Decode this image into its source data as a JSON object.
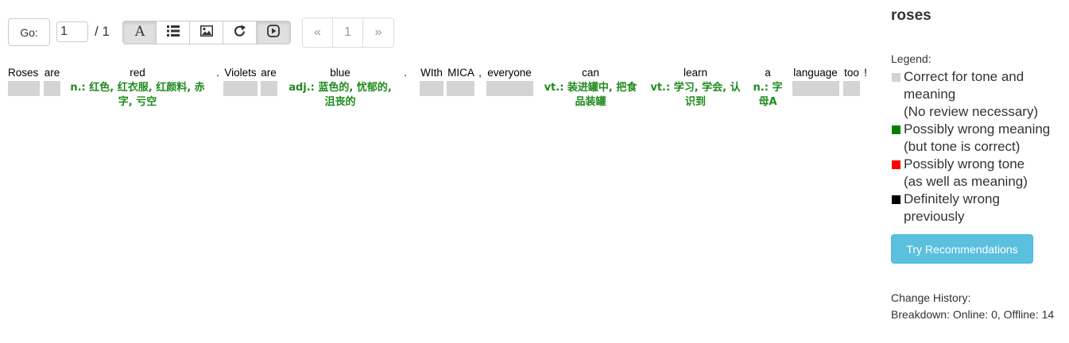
{
  "toolbar": {
    "go_label": "Go:",
    "page_value": "1",
    "page_total": "/ 1",
    "buttons": [
      {
        "icon": "font-icon"
      },
      {
        "icon": "list-icon"
      },
      {
        "icon": "image-icon"
      },
      {
        "icon": "share-icon"
      },
      {
        "icon": "play-icon"
      }
    ]
  },
  "pagination": {
    "prev": "«",
    "current": "1",
    "next": "»"
  },
  "words": [
    {
      "text": "Roses"
    },
    {
      "text": "are"
    },
    {
      "text": "red",
      "translation": [
        "n.: 红色, 红衣服, 红颜料, 赤",
        "字, 亏空"
      ]
    },
    {
      "text": "."
    },
    {
      "text": "Violets"
    },
    {
      "text": "are"
    },
    {
      "text": "blue",
      "translation": [
        "adj.: 蓝色的, 忧郁的,",
        "沮丧的"
      ]
    },
    {
      "text": "."
    },
    {
      "text": "WIth"
    },
    {
      "text": "MICA"
    },
    {
      "text": ","
    },
    {
      "text": "everyone"
    },
    {
      "text": "can",
      "translation": [
        "vt.: 装进罐中, 把食",
        "品装罐"
      ]
    },
    {
      "text": "learn",
      "translation": [
        "vt.: 学习, 学会, 认",
        "识到"
      ]
    },
    {
      "text": "a",
      "translation": [
        "n.: 字",
        "母A"
      ]
    },
    {
      "text": "language"
    },
    {
      "text": "too"
    },
    {
      "text": "!"
    }
  ],
  "sidebar": {
    "title": "roses",
    "legend_label": "Legend:",
    "legend": [
      {
        "lines": [
          "Correct for tone and",
          "meaning",
          "(No review necessary)"
        ],
        "color": "#d3d3d3"
      },
      {
        "lines": [
          "Possibly wrong meaning",
          "(but tone is correct)"
        ],
        "color": "#008000"
      },
      {
        "lines": [
          "Possibly wrong tone",
          "(as well as meaning)"
        ],
        "color": "#ff0000"
      },
      {
        "lines": [
          "Definitely wrong",
          "previously"
        ],
        "color": "#000000"
      }
    ],
    "try_button": "Try Recommendations",
    "history_label": "Change History:",
    "history_breakdown": "Breakdown: Online: 0, Offline: 14"
  }
}
